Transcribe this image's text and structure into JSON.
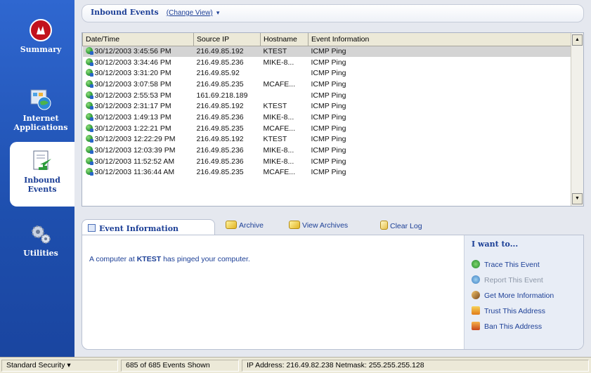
{
  "nav": {
    "items": [
      {
        "label": "Summary",
        "icon": "shield-logo-icon"
      },
      {
        "label": "Internet Applications",
        "icon": "internet-apps-icon"
      },
      {
        "label": "Inbound Events",
        "icon": "inbound-events-icon"
      },
      {
        "label": "Utilities",
        "icon": "gears-icon"
      }
    ],
    "active": "Inbound Events"
  },
  "header": {
    "title": "Inbound Events",
    "change_view": "(Change View)"
  },
  "table": {
    "columns": [
      "Date/Time",
      "Source IP",
      "Hostname",
      "Event Information"
    ],
    "rows": [
      [
        "30/12/2003 3:45:56 PM",
        "216.49.85.192",
        "KTEST",
        "ICMP Ping"
      ],
      [
        "30/12/2003 3:34:46 PM",
        "216.49.85.236",
        "MIKE-8...",
        "ICMP Ping"
      ],
      [
        "30/12/2003 3:31:20 PM",
        "216.49.85.92",
        "",
        "ICMP Ping"
      ],
      [
        "30/12/2003 3:07:58 PM",
        "216.49.85.235",
        "MCAFE...",
        "ICMP Ping"
      ],
      [
        "30/12/2003 2:55:53 PM",
        "161.69.218.189",
        "",
        "ICMP Ping"
      ],
      [
        "30/12/2003 2:31:17 PM",
        "216.49.85.192",
        "KTEST",
        "ICMP Ping"
      ],
      [
        "30/12/2003 1:49:13 PM",
        "216.49.85.236",
        "MIKE-8...",
        "ICMP Ping"
      ],
      [
        "30/12/2003 1:22:21 PM",
        "216.49.85.235",
        "MCAFE...",
        "ICMP Ping"
      ],
      [
        "30/12/2003 12:22:29 PM",
        "216.49.85.192",
        "KTEST",
        "ICMP Ping"
      ],
      [
        "30/12/2003 12:03:39 PM",
        "216.49.85.236",
        "MIKE-8...",
        "ICMP Ping"
      ],
      [
        "30/12/2003 11:52:52 AM",
        "216.49.85.236",
        "MIKE-8...",
        "ICMP Ping"
      ],
      [
        "30/12/2003 11:36:44 AM",
        "216.49.85.235",
        "MCAFE...",
        "ICMP Ping"
      ]
    ],
    "selected_row": 0
  },
  "toolbar": {
    "event_info_tab": "Event Information",
    "archive": "Archive",
    "view_archives": "View Archives",
    "clear_log": "Clear Log"
  },
  "info": {
    "message_prefix": "A computer at",
    "host": "KTEST",
    "message_suffix": "has pinged your computer."
  },
  "iwant": {
    "title": "I want to...",
    "items": [
      {
        "label": "Trace This Event",
        "icon": "trace-icon",
        "enabled": true
      },
      {
        "label": "Report This Event",
        "icon": "report-icon",
        "enabled": false
      },
      {
        "label": "Get More Information",
        "icon": "info-people-icon",
        "enabled": true
      },
      {
        "label": "Trust This Address",
        "icon": "trust-icon",
        "enabled": true
      },
      {
        "label": "Ban This Address",
        "icon": "ban-icon",
        "enabled": true
      }
    ]
  },
  "status": {
    "security": "Standard Security ▾",
    "events_shown": "685 of 685 Events Shown",
    "ip_info": "IP Address: 216.49.82.238  Netmask: 255.255.255.128"
  }
}
